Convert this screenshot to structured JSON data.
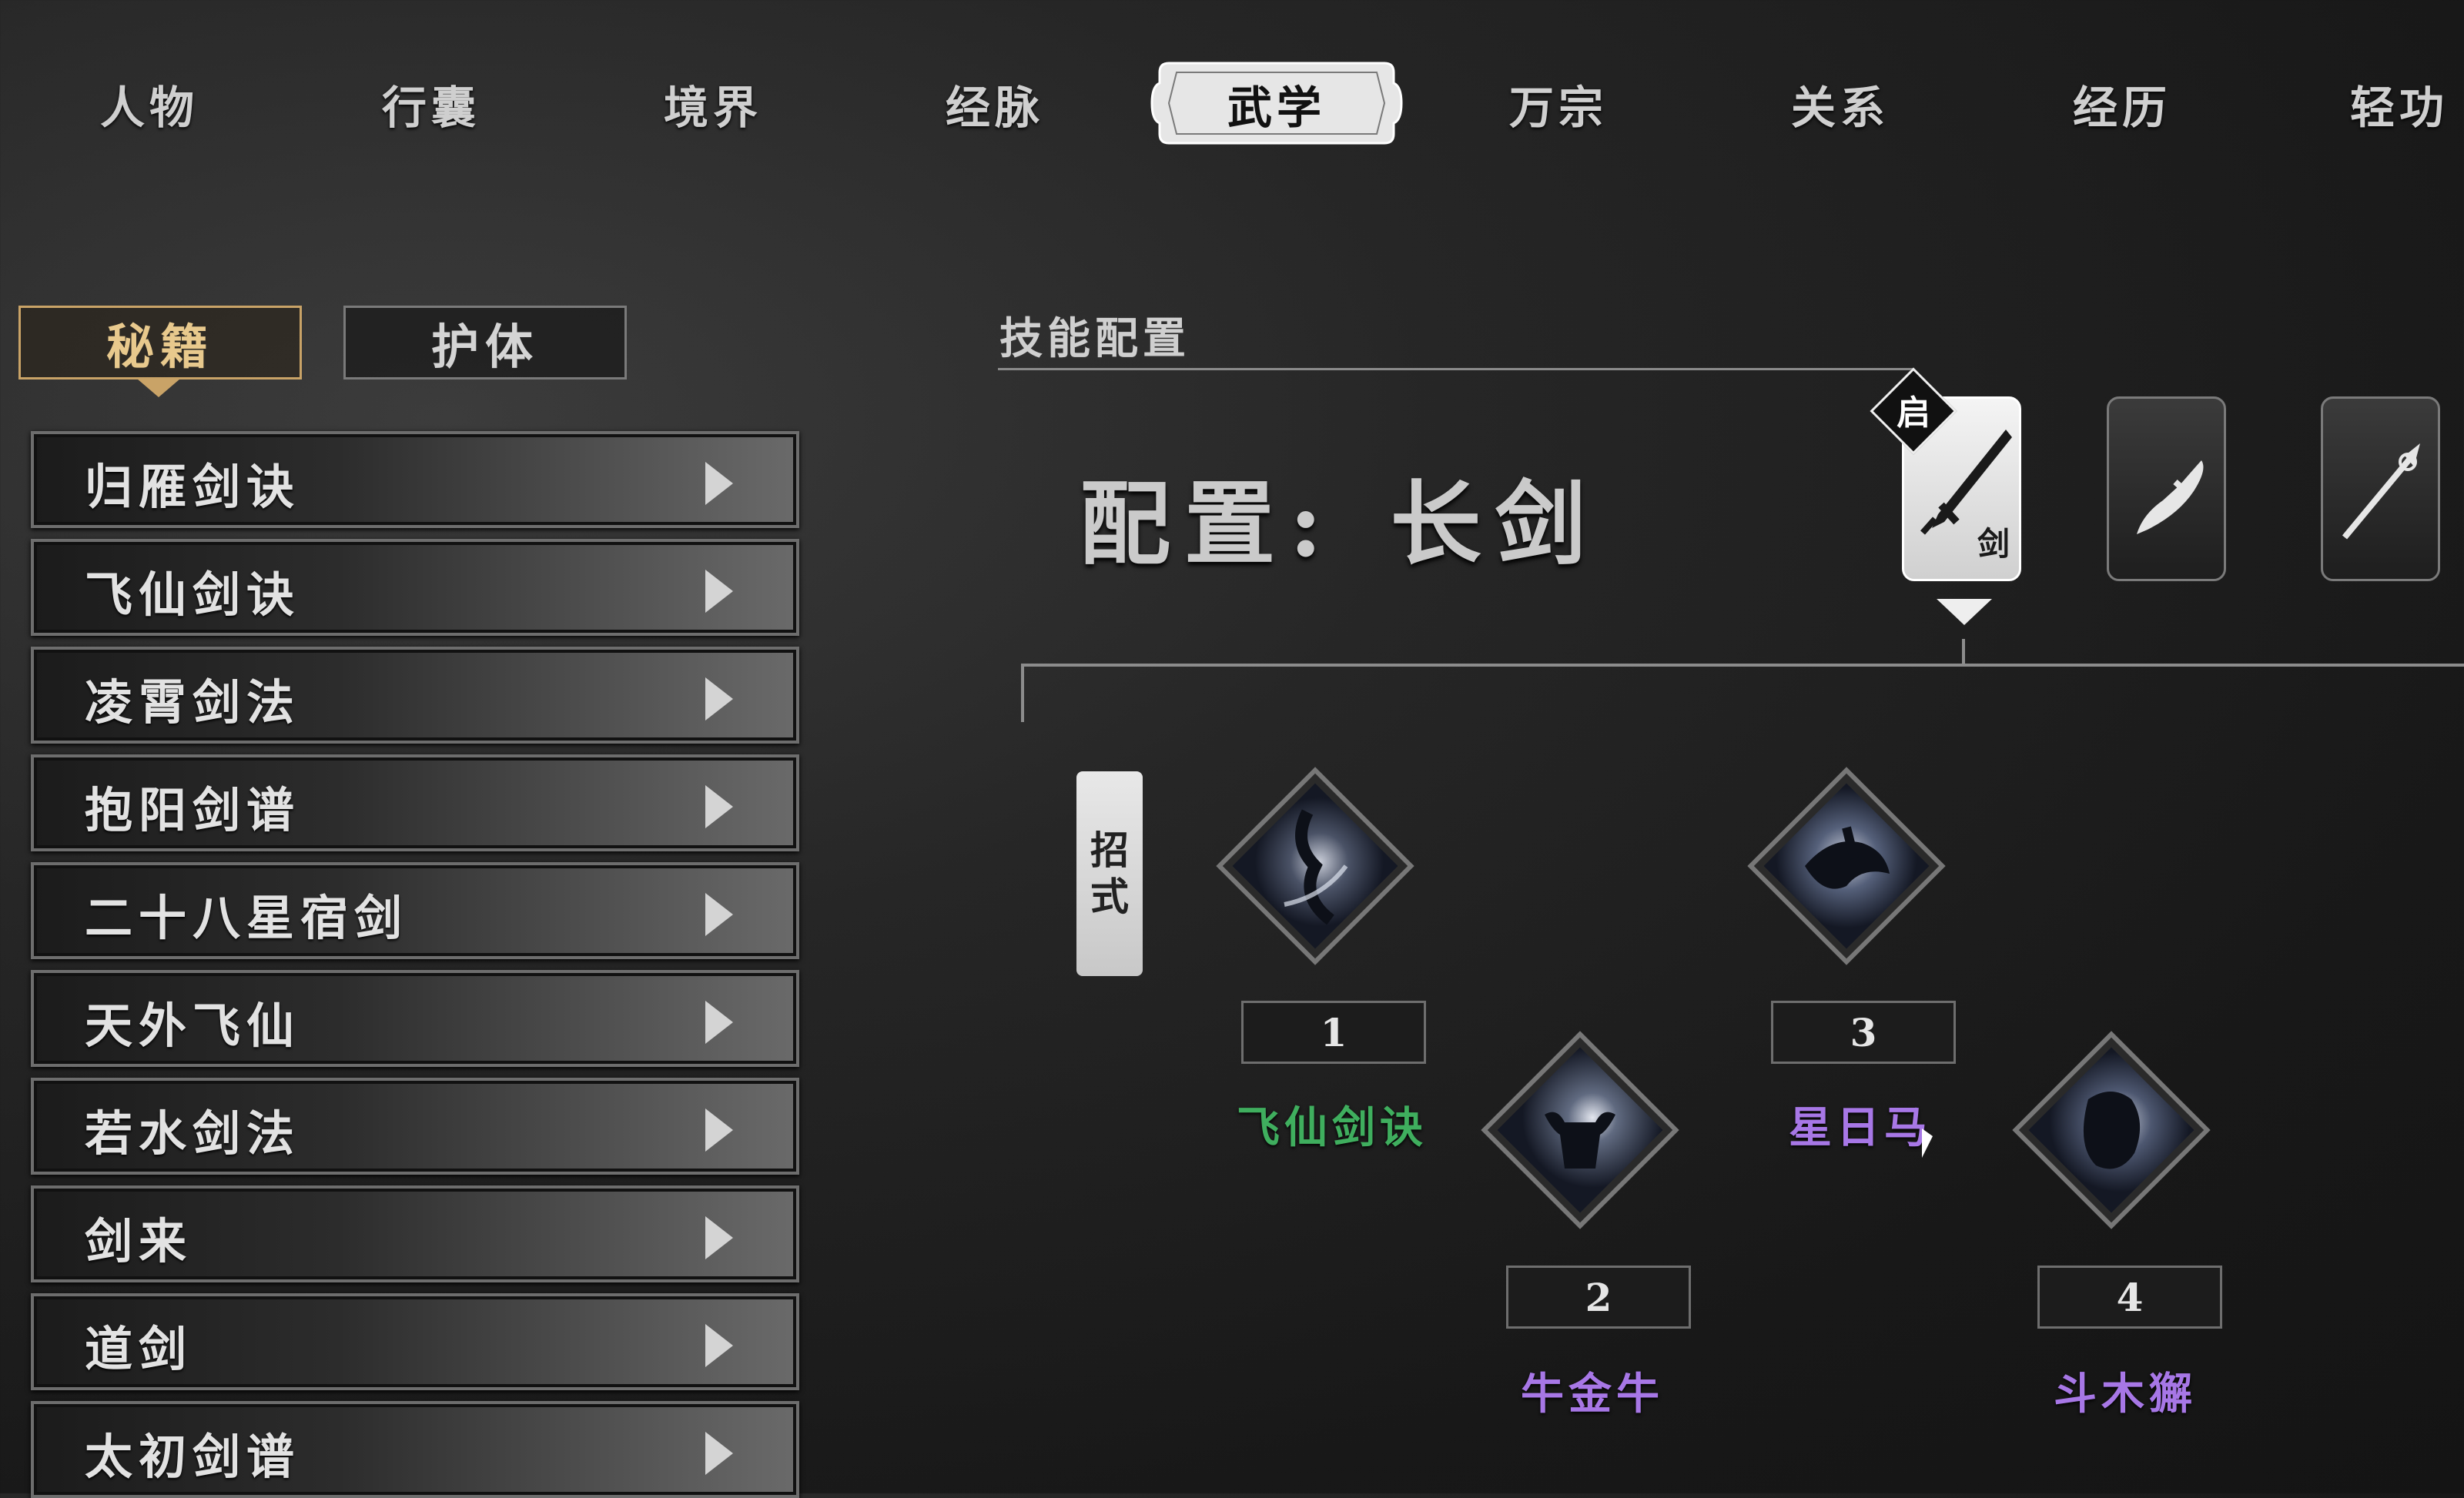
{
  "top_tabs": [
    "人物",
    "行囊",
    "境界",
    "经脉",
    "武学",
    "万宗",
    "关系",
    "经历",
    "轻功"
  ],
  "active_top_tab": "武学",
  "sub_tabs": [
    "秘籍",
    "护体"
  ],
  "active_sub_tab": "秘籍",
  "manuals": [
    "归雁剑诀",
    "飞仙剑诀",
    "凌霄剑法",
    "抱阳剑谱",
    "二十八星宿剑",
    "天外飞仙",
    "若水剑法",
    "剑来",
    "道剑",
    "太初剑谱"
  ],
  "skill_config": {
    "section_title": "技能配置",
    "config_label": "配置:",
    "config_weapon": "长剑",
    "active_badge": "启",
    "active_card_char": "剑",
    "weapons": [
      {
        "icon": "long-sword-icon",
        "active": true
      },
      {
        "icon": "broadsword-icon",
        "active": false
      },
      {
        "icon": "spear-icon",
        "active": false
      }
    ],
    "moves_label": [
      "招",
      "式"
    ],
    "slots": [
      {
        "number": "1",
        "name": "飞仙剑诀",
        "color": "#3fae5e"
      },
      {
        "number": "2",
        "name": "牛金牛",
        "color": "#a777e6"
      },
      {
        "number": "3",
        "name": "星日马",
        "color": "#a777e6"
      },
      {
        "number": "4",
        "name": "斗木獬",
        "color": "#a777e6"
      }
    ]
  },
  "colors": {
    "accent": "#c9a367",
    "green_rarity": "#3fae5e",
    "purple_rarity": "#a777e6"
  }
}
